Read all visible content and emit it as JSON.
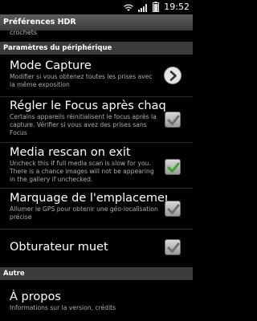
{
  "status_bar": {
    "time": "19:52"
  },
  "app_title": "Préférences HDR",
  "partial_text": "crochets",
  "sections": [
    {
      "header": "Paramètres du périphérique",
      "items": [
        {
          "title": "Mode Capture",
          "summary": "Modifier si vous obtenez toutes les prises avec la même exposition",
          "widget": "chevron"
        },
        {
          "title": "Régler le Focus après chaque p",
          "summary": "Certains appareils réinitialisent le focus après la capture. Vérifier si vous avez des prises sans Focus",
          "widget": "checkbox",
          "checked": true,
          "enabled": false
        },
        {
          "title": "Media rescan on exit",
          "summary": "Uncheck this if full media scan is slow for you. There is a chance images will not be appearing in the gallery if unchecked.",
          "widget": "checkbox",
          "checked": true,
          "enabled": true
        },
        {
          "title": "Marquage de l'emplacement",
          "summary": "Allumer le GPS pour obtenir une géo-localisation précise",
          "widget": "checkbox",
          "checked": true,
          "enabled": false
        },
        {
          "title": "Obturateur muet",
          "summary": "",
          "widget": "checkbox",
          "checked": true,
          "enabled": false
        }
      ]
    },
    {
      "header": "Autre",
      "items": [
        {
          "title": "À propos",
          "summary": "Informations sur la version, crédits"
        }
      ]
    }
  ],
  "colors": {
    "accent_check": "#2fa82f",
    "disabled_check": "#6f6f6f",
    "category_bg": "#3b3b3b"
  }
}
